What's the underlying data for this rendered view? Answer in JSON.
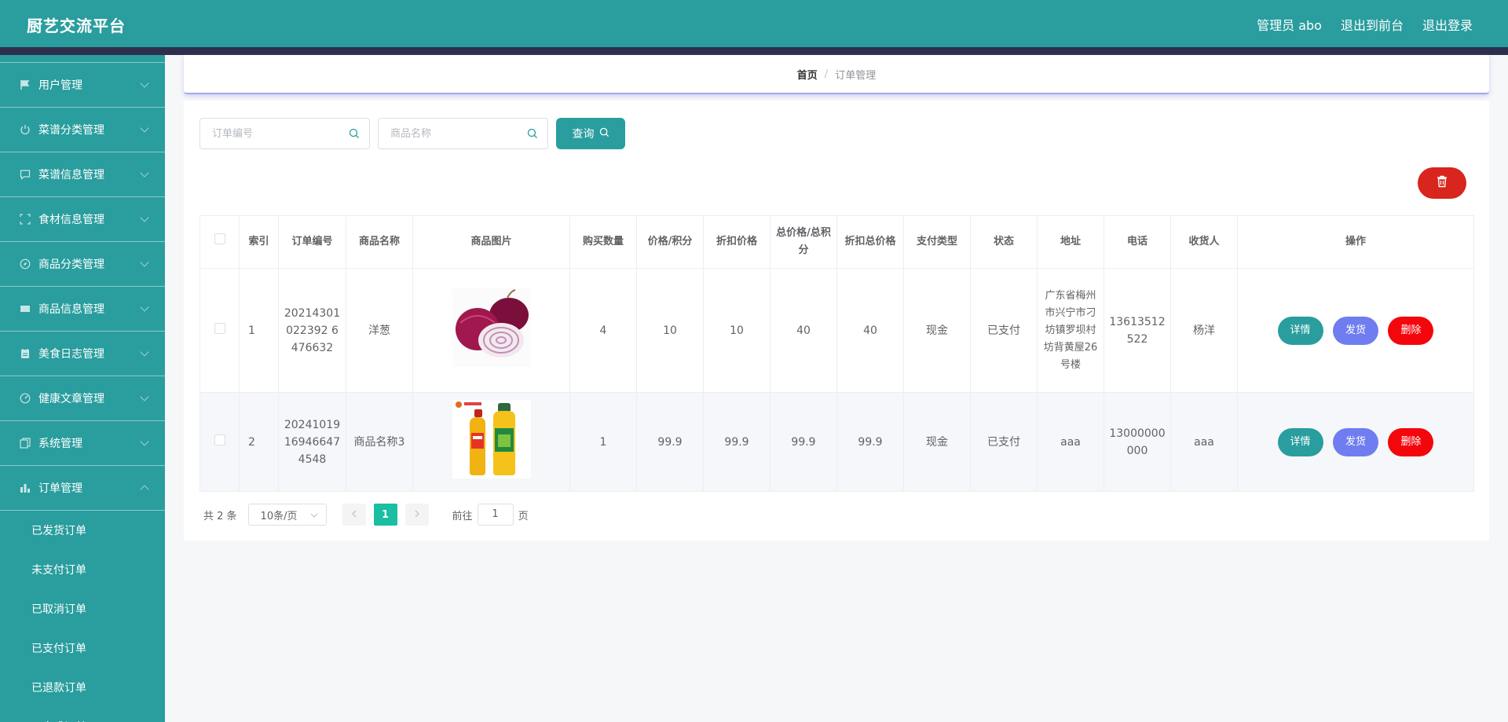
{
  "header": {
    "brand": "厨艺交流平台",
    "admin": "管理员 abo",
    "to_front": "退出到前台",
    "logout": "退出登录"
  },
  "sidebar": {
    "items": [
      {
        "label": "用户管理",
        "icon": "flag-icon"
      },
      {
        "label": "菜谱分类管理",
        "icon": "power-icon"
      },
      {
        "label": "菜谱信息管理",
        "icon": "chat-icon"
      },
      {
        "label": "食材信息管理",
        "icon": "frame-icon"
      },
      {
        "label": "商品分类管理",
        "icon": "compass-icon"
      },
      {
        "label": "商品信息管理",
        "icon": "ticket-icon"
      },
      {
        "label": "美食日志管理",
        "icon": "notebook-icon"
      },
      {
        "label": "健康文章管理",
        "icon": "gauge-icon"
      },
      {
        "label": "系统管理",
        "icon": "copy-icon"
      },
      {
        "label": "订单管理",
        "icon": "chart-icon"
      }
    ],
    "subitems": [
      "已发货订单",
      "未支付订单",
      "已取消订单",
      "已支付订单",
      "已退款订单",
      "已完成订单"
    ]
  },
  "breadcrumb": {
    "home": "首页",
    "separator": "/",
    "current": "订单管理"
  },
  "search": {
    "order_no_placeholder": "订单编号",
    "product_name_placeholder": "商品名称",
    "query_label": "查询"
  },
  "table": {
    "headers": [
      "索引",
      "订单编号",
      "商品名称",
      "商品图片",
      "购买数量",
      "价格/积分",
      "折扣价格",
      "总价格/总积分",
      "折扣总价格",
      "支付类型",
      "状态",
      "地址",
      "电话",
      "收货人",
      "操作"
    ],
    "rows": [
      {
        "index": "1",
        "order_no": "20214301022392 6476632",
        "product": "洋葱",
        "image": "onion",
        "qty": "4",
        "price": "10",
        "discount_price": "10",
        "total": "40",
        "discount_total": "40",
        "pay_type": "现金",
        "status": "已支付",
        "address": "广东省梅州市兴宁市刁坊镇罗坝村坊背黄屋26号楼",
        "phone": "13613512522",
        "receiver": "杨洋"
      },
      {
        "index": "2",
        "order_no": "20241019169466474548",
        "product": "商品名称3",
        "image": "cooking-oil",
        "qty": "1",
        "price": "99.9",
        "discount_price": "99.9",
        "total": "99.9",
        "discount_total": "99.9",
        "pay_type": "现金",
        "status": "已支付",
        "address": "aaa",
        "phone": "13000000000",
        "receiver": "aaa"
      }
    ],
    "actions": {
      "detail": "详情",
      "ship": "发货",
      "delete": "删除"
    }
  },
  "pagination": {
    "total": "共 2 条",
    "page_size": "10条/页",
    "current_page": "1",
    "goto_prefix": "前往",
    "goto_value": "1",
    "goto_suffix": "页"
  },
  "colors": {
    "primary": "#2a9d9e",
    "ship": "#6f7df0",
    "delete": "#f3070c",
    "page_active": "#19bfa0"
  }
}
